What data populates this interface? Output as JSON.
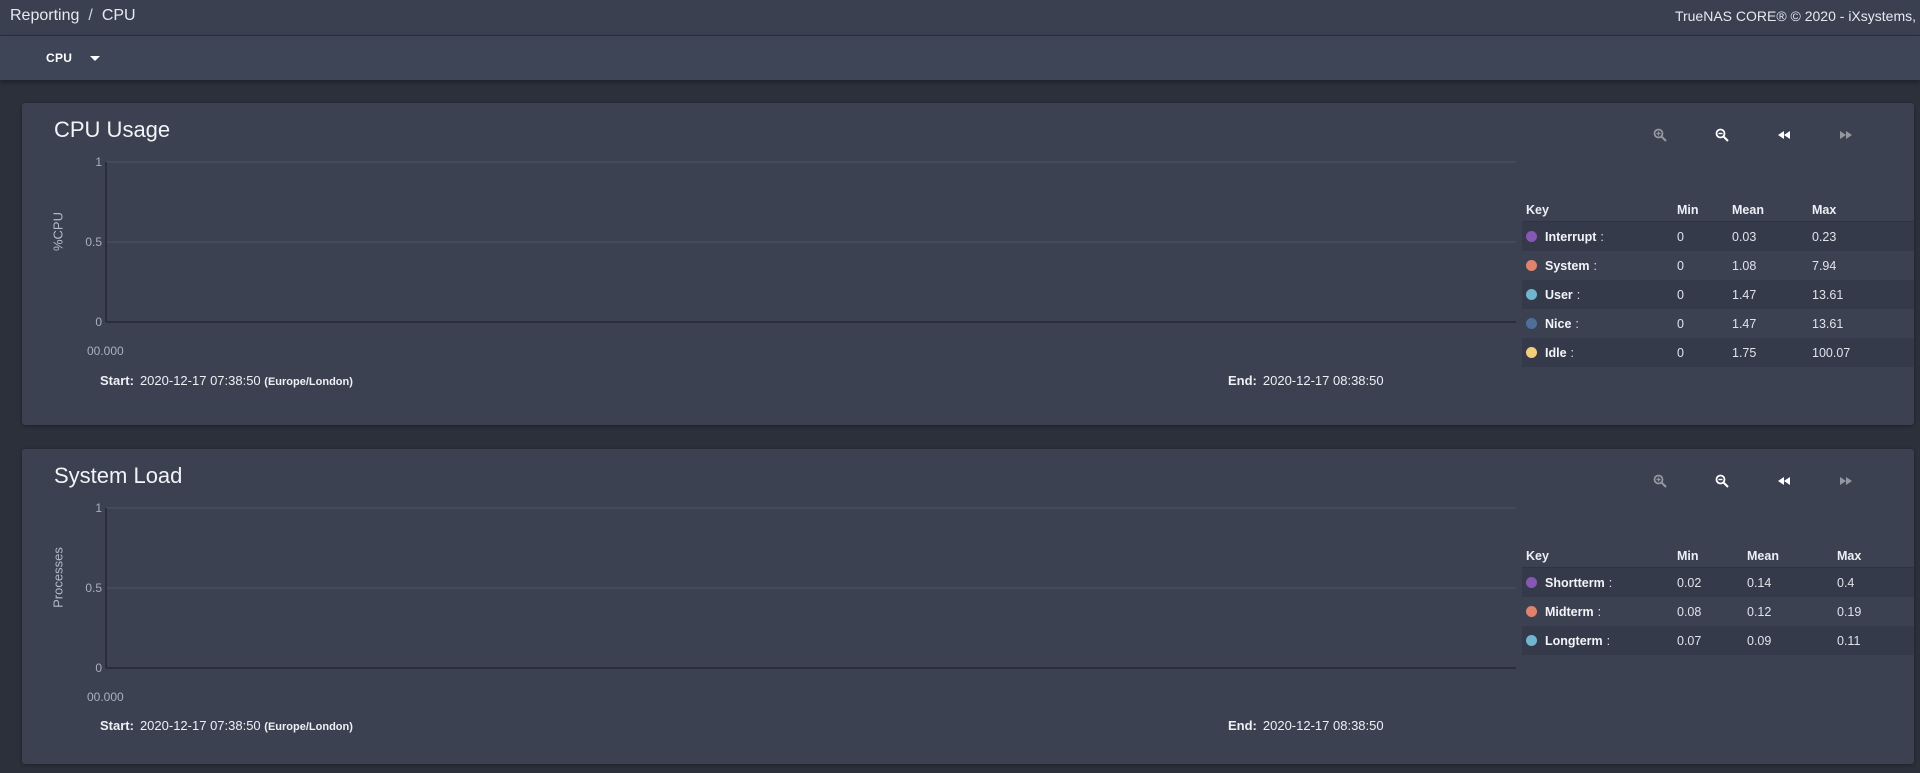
{
  "breadcrumb": {
    "parent": "Reporting",
    "separator": "/",
    "current": "CPU"
  },
  "copyright": "TrueNAS CORE® © 2020 - iXsystems,",
  "report_select": {
    "selected": "CPU"
  },
  "icons": {
    "zoom_in": "zoom-in-icon",
    "zoom_out": "zoom-out-icon",
    "step_back": "rewind-icon",
    "step_forward": "fast-forward-icon"
  },
  "charts": [
    {
      "title": "CPU Usage",
      "ylabel": "%CPU",
      "x_start": "00.000",
      "start_label": "Start:",
      "start_value": "2020-12-17 07:38:50",
      "timezone": "(Europe/London)",
      "end_label": "End:",
      "end_value": "2020-12-17 08:38:50",
      "legend_headers": {
        "key": "Key",
        "min": "Min",
        "mean": "Mean",
        "max": "Max"
      },
      "legend": [
        {
          "name": "Interrupt",
          "color": "#8458b3",
          "min": "0",
          "mean": "0.03",
          "max": "0.23"
        },
        {
          "name": "System",
          "color": "#e0826e",
          "min": "0",
          "mean": "1.08",
          "max": "7.94"
        },
        {
          "name": "User",
          "color": "#71b5cf",
          "min": "0",
          "mean": "1.47",
          "max": "13.61"
        },
        {
          "name": "Nice",
          "color": "#4f6f9a",
          "min": "0",
          "mean": "1.47",
          "max": "13.61"
        },
        {
          "name": "Idle",
          "color": "#f1cf7d",
          "min": "0",
          "mean": "1.75",
          "max": "100.07"
        }
      ]
    },
    {
      "title": "System Load",
      "ylabel": "Processes",
      "x_start": "00.000",
      "start_label": "Start:",
      "start_value": "2020-12-17 07:38:50",
      "timezone": "(Europe/London)",
      "end_label": "End:",
      "end_value": "2020-12-17 08:38:50",
      "legend_headers": {
        "key": "Key",
        "min": "Min",
        "mean": "Mean",
        "max": "Max"
      },
      "legend": [
        {
          "name": "Shortterm",
          "color": "#8458b3",
          "min": "0.02",
          "mean": "0.14",
          "max": "0.4"
        },
        {
          "name": "Midterm",
          "color": "#e0826e",
          "min": "0.08",
          "mean": "0.12",
          "max": "0.19"
        },
        {
          "name": "Longterm",
          "color": "#71b5cf",
          "min": "0.07",
          "mean": "0.09",
          "max": "0.11"
        }
      ]
    }
  ],
  "chart_data": [
    {
      "type": "line",
      "title": "CPU Usage",
      "ylabel": "%CPU",
      "ylim": [
        0,
        1
      ],
      "yticks": [
        "0",
        "0.5",
        "1"
      ],
      "x_ticks": [
        "00.000"
      ],
      "grid": true,
      "series": []
    },
    {
      "type": "line",
      "title": "System Load",
      "ylabel": "Processes",
      "ylim": [
        0,
        1
      ],
      "yticks": [
        "0",
        "0.5",
        "1"
      ],
      "x_ticks": [
        "00.000"
      ],
      "grid": true,
      "series": []
    }
  ]
}
